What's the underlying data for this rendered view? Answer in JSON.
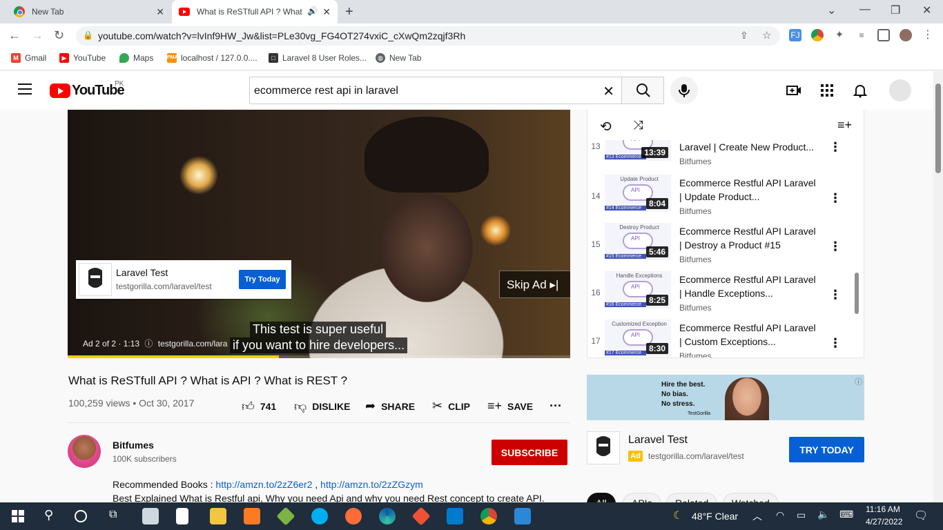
{
  "browser": {
    "tabs": [
      {
        "title": "New Tab"
      },
      {
        "title": "What is ReSTfull API ? What"
      }
    ],
    "url": "youtube.com/watch?v=lvInf9HW_Jw&list=PLe30vg_FG4OT274vxiC_cXwQm2zqjf3Rh",
    "bookmarks": [
      "Gmail",
      "YouTube",
      "Maps",
      "localhost / 127.0.0....",
      "Laravel 8 User Roles...",
      "New Tab"
    ]
  },
  "youtube": {
    "logo_text": "YouTube",
    "country_code": "PK",
    "search_query": "ecommerce rest api  in laravel"
  },
  "player": {
    "ad_card": {
      "title": "Laravel Test",
      "url": "testgorilla.com/laravel/test",
      "button": "Try Today"
    },
    "skip_ad": "Skip Ad",
    "caption_line1": "This test is super useful",
    "caption_line2": "if you want to hire developers...",
    "ad_info": "Ad 2 of 2 · 1:13",
    "ad_url": "testgorilla.com/lara",
    "progress_fraction": 0.42
  },
  "video": {
    "title": "What is ReSTfull API ? What is API ? What is REST ?",
    "meta": "100,259 views • Oct 30, 2017",
    "likes": "741",
    "dislike": "DISLIKE",
    "share": "SHARE",
    "clip": "CLIP",
    "save": "SAVE"
  },
  "channel": {
    "name": "Bitfumes",
    "subs": "100K subscribers",
    "subscribe": "SUBSCRIBE"
  },
  "description": {
    "line1_prefix": "Recommended Books : ",
    "link1": "http://amzn.to/2zZ6er2",
    "sep": " , ",
    "link2": "http://amzn.to/2zZGzym",
    "line2": "Best Explained What is Restful api, Why you need Api and why you need Rest concept to create API."
  },
  "playlist": {
    "items": [
      {
        "index": "13",
        "thumb_title": "",
        "thumb_sub": "#13 Ecommerce",
        "duration": "13:39",
        "title": "Laravel | Create New Product...",
        "channel": "Bitfumes"
      },
      {
        "index": "14",
        "thumb_title": "Update Product",
        "thumb_sub": "#14 Ecommerce",
        "duration": "8:04",
        "title": "Ecommerce Restful API Laravel | Update Product...",
        "channel": "Bitfumes"
      },
      {
        "index": "15",
        "thumb_title": "Destroy Product",
        "thumb_sub": "#15 Ecommerce",
        "duration": "5:46",
        "title": "Ecommerce Restful API Laravel | Destroy a Product #15",
        "channel": "Bitfumes"
      },
      {
        "index": "16",
        "thumb_title": "Handle Exceptions",
        "thumb_sub": "#16 Ecommerce",
        "duration": "8:25",
        "title": "Ecommerce Restful API Laravel | Handle Exceptions...",
        "channel": "Bitfumes"
      },
      {
        "index": "17",
        "thumb_title": "Customized Exception",
        "thumb_sub": "#17 Ecommerce",
        "duration": "8:30",
        "title": "Ecommerce Restful API Laravel | Custom Exceptions...",
        "channel": "Bitfumes"
      }
    ]
  },
  "sidebar_ad": {
    "banner_lines": [
      "Hire the best.",
      "No bias.",
      "No stress."
    ],
    "banner_brand": "TestGorilla",
    "title": "Laravel Test",
    "badge": "Ad",
    "url": "testgorilla.com/laravel/test",
    "button": "TRY TODAY"
  },
  "chips": [
    "All",
    "APIs",
    "Related",
    "Watched"
  ],
  "taskbar": {
    "weather": "48°F  Clear",
    "time": "11:16 AM",
    "date": "4/27/2022"
  }
}
